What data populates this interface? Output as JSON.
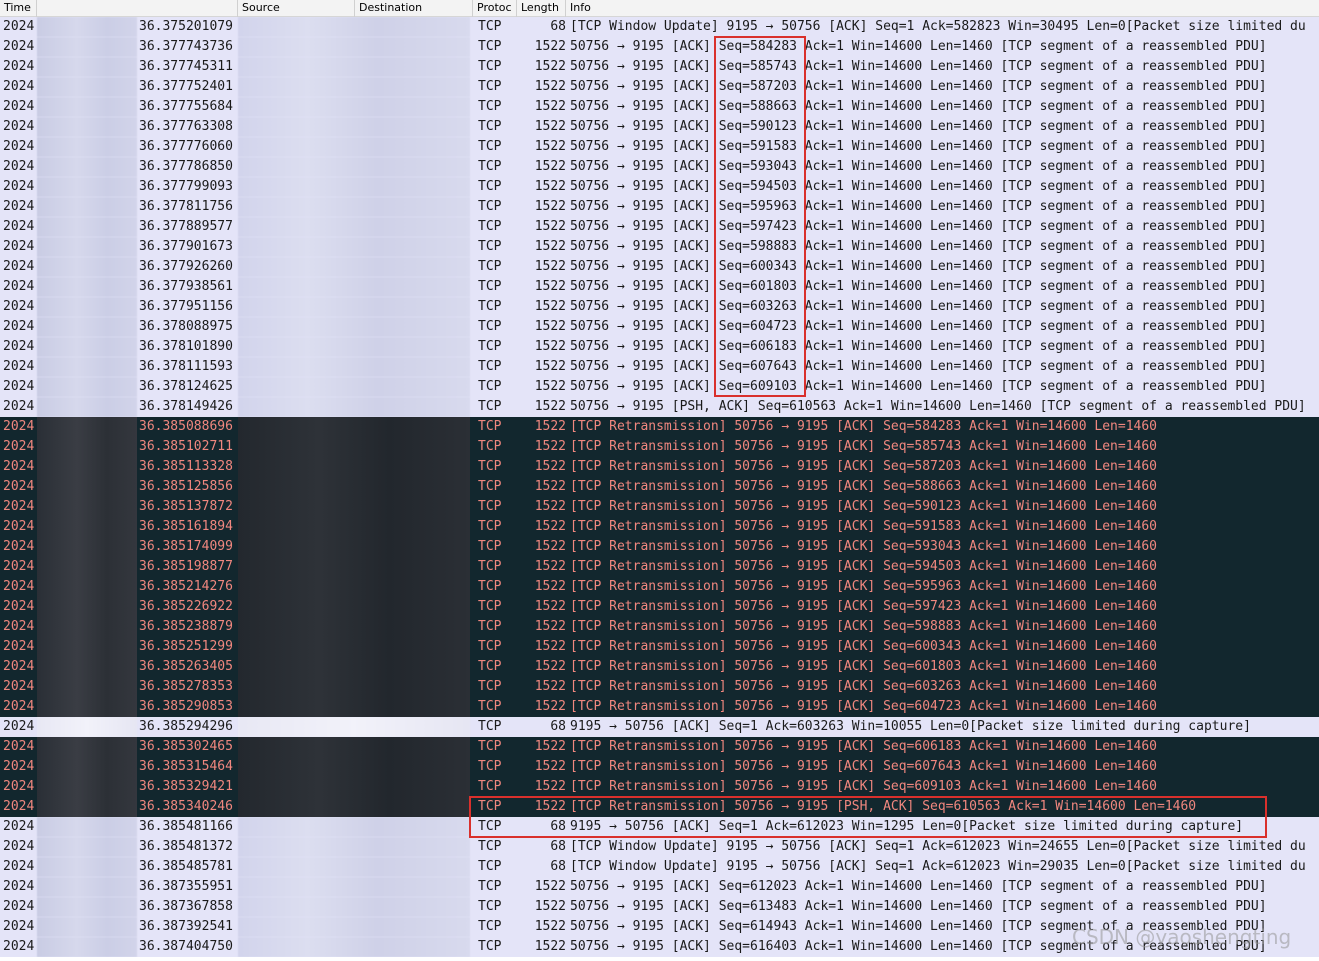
{
  "columns": {
    "time": "Time",
    "source": "Source",
    "destination": "Destination",
    "protocol": "Protoc",
    "length": "Length",
    "info": "Info"
  },
  "rows": [
    {
      "t": "2024",
      "rel": "36.375201079",
      "proto": "TCP",
      "len": "68",
      "info": "[TCP Window Update] 9195 → 50756 [ACK] Seq=1 Ack=582823 Win=30495 Len=0[Packet size limited du",
      "style": "normal"
    },
    {
      "t": "2024",
      "rel": "36.377743736",
      "proto": "TCP",
      "len": "1522",
      "info": "50756 → 9195 [ACK] Seq=584283 Ack=1 Win=14600 Len=1460 [TCP segment of a reassembled PDU]",
      "style": "normal"
    },
    {
      "t": "2024",
      "rel": "36.377745311",
      "proto": "TCP",
      "len": "1522",
      "info": "50756 → 9195 [ACK] Seq=585743 Ack=1 Win=14600 Len=1460 [TCP segment of a reassembled PDU]",
      "style": "normal"
    },
    {
      "t": "2024",
      "rel": "36.377752401",
      "proto": "TCP",
      "len": "1522",
      "info": "50756 → 9195 [ACK] Seq=587203 Ack=1 Win=14600 Len=1460 [TCP segment of a reassembled PDU]",
      "style": "normal"
    },
    {
      "t": "2024",
      "rel": "36.377755684",
      "proto": "TCP",
      "len": "1522",
      "info": "50756 → 9195 [ACK] Seq=588663 Ack=1 Win=14600 Len=1460 [TCP segment of a reassembled PDU]",
      "style": "normal"
    },
    {
      "t": "2024",
      "rel": "36.377763308",
      "proto": "TCP",
      "len": "1522",
      "info": "50756 → 9195 [ACK] Seq=590123 Ack=1 Win=14600 Len=1460 [TCP segment of a reassembled PDU]",
      "style": "normal"
    },
    {
      "t": "2024",
      "rel": "36.377776060",
      "proto": "TCP",
      "len": "1522",
      "info": "50756 → 9195 [ACK] Seq=591583 Ack=1 Win=14600 Len=1460 [TCP segment of a reassembled PDU]",
      "style": "normal"
    },
    {
      "t": "2024",
      "rel": "36.377786850",
      "proto": "TCP",
      "len": "1522",
      "info": "50756 → 9195 [ACK] Seq=593043 Ack=1 Win=14600 Len=1460 [TCP segment of a reassembled PDU]",
      "style": "normal"
    },
    {
      "t": "2024",
      "rel": "36.377799093",
      "proto": "TCP",
      "len": "1522",
      "info": "50756 → 9195 [ACK] Seq=594503 Ack=1 Win=14600 Len=1460 [TCP segment of a reassembled PDU]",
      "style": "normal"
    },
    {
      "t": "2024",
      "rel": "36.377811756",
      "proto": "TCP",
      "len": "1522",
      "info": "50756 → 9195 [ACK] Seq=595963 Ack=1 Win=14600 Len=1460 [TCP segment of a reassembled PDU]",
      "style": "normal"
    },
    {
      "t": "2024",
      "rel": "36.377889577",
      "proto": "TCP",
      "len": "1522",
      "info": "50756 → 9195 [ACK] Seq=597423 Ack=1 Win=14600 Len=1460 [TCP segment of a reassembled PDU]",
      "style": "normal"
    },
    {
      "t": "2024",
      "rel": "36.377901673",
      "proto": "TCP",
      "len": "1522",
      "info": "50756 → 9195 [ACK] Seq=598883 Ack=1 Win=14600 Len=1460 [TCP segment of a reassembled PDU]",
      "style": "normal"
    },
    {
      "t": "2024",
      "rel": "36.377926260",
      "proto": "TCP",
      "len": "1522",
      "info": "50756 → 9195 [ACK] Seq=600343 Ack=1 Win=14600 Len=1460 [TCP segment of a reassembled PDU]",
      "style": "normal"
    },
    {
      "t": "2024",
      "rel": "36.377938561",
      "proto": "TCP",
      "len": "1522",
      "info": "50756 → 9195 [ACK] Seq=601803 Ack=1 Win=14600 Len=1460 [TCP segment of a reassembled PDU]",
      "style": "normal"
    },
    {
      "t": "2024",
      "rel": "36.377951156",
      "proto": "TCP",
      "len": "1522",
      "info": "50756 → 9195 [ACK] Seq=603263 Ack=1 Win=14600 Len=1460 [TCP segment of a reassembled PDU]",
      "style": "normal"
    },
    {
      "t": "2024",
      "rel": "36.378088975",
      "proto": "TCP",
      "len": "1522",
      "info": "50756 → 9195 [ACK] Seq=604723 Ack=1 Win=14600 Len=1460 [TCP segment of a reassembled PDU]",
      "style": "normal"
    },
    {
      "t": "2024",
      "rel": "36.378101890",
      "proto": "TCP",
      "len": "1522",
      "info": "50756 → 9195 [ACK] Seq=606183 Ack=1 Win=14600 Len=1460 [TCP segment of a reassembled PDU]",
      "style": "normal"
    },
    {
      "t": "2024",
      "rel": "36.378111593",
      "proto": "TCP",
      "len": "1522",
      "info": "50756 → 9195 [ACK] Seq=607643 Ack=1 Win=14600 Len=1460 [TCP segment of a reassembled PDU]",
      "style": "normal"
    },
    {
      "t": "2024",
      "rel": "36.378124625",
      "proto": "TCP",
      "len": "1522",
      "info": "50756 → 9195 [ACK] Seq=609103 Ack=1 Win=14600 Len=1460 [TCP segment of a reassembled PDU]",
      "style": "normal"
    },
    {
      "t": "2024",
      "rel": "36.378149426",
      "proto": "TCP",
      "len": "1522",
      "info": "50756 → 9195 [PSH, ACK] Seq=610563 Ack=1 Win=14600 Len=1460 [TCP segment of a reassembled PDU]",
      "style": "normal"
    },
    {
      "t": "2024",
      "rel": "36.385088696",
      "proto": "TCP",
      "len": "1522",
      "info": "[TCP Retransmission] 50756 → 9195 [ACK] Seq=584283 Ack=1 Win=14600 Len=1460",
      "style": "retx"
    },
    {
      "t": "2024",
      "rel": "36.385102711",
      "proto": "TCP",
      "len": "1522",
      "info": "[TCP Retransmission] 50756 → 9195 [ACK] Seq=585743 Ack=1 Win=14600 Len=1460",
      "style": "retx"
    },
    {
      "t": "2024",
      "rel": "36.385113328",
      "proto": "TCP",
      "len": "1522",
      "info": "[TCP Retransmission] 50756 → 9195 [ACK] Seq=587203 Ack=1 Win=14600 Len=1460",
      "style": "retx"
    },
    {
      "t": "2024",
      "rel": "36.385125856",
      "proto": "TCP",
      "len": "1522",
      "info": "[TCP Retransmission] 50756 → 9195 [ACK] Seq=588663 Ack=1 Win=14600 Len=1460",
      "style": "retx"
    },
    {
      "t": "2024",
      "rel": "36.385137872",
      "proto": "TCP",
      "len": "1522",
      "info": "[TCP Retransmission] 50756 → 9195 [ACK] Seq=590123 Ack=1 Win=14600 Len=1460",
      "style": "retx"
    },
    {
      "t": "2024",
      "rel": "36.385161894",
      "proto": "TCP",
      "len": "1522",
      "info": "[TCP Retransmission] 50756 → 9195 [ACK] Seq=591583 Ack=1 Win=14600 Len=1460",
      "style": "retx"
    },
    {
      "t": "2024",
      "rel": "36.385174099",
      "proto": "TCP",
      "len": "1522",
      "info": "[TCP Retransmission] 50756 → 9195 [ACK] Seq=593043 Ack=1 Win=14600 Len=1460",
      "style": "retx"
    },
    {
      "t": "2024",
      "rel": "36.385198877",
      "proto": "TCP",
      "len": "1522",
      "info": "[TCP Retransmission] 50756 → 9195 [ACK] Seq=594503 Ack=1 Win=14600 Len=1460",
      "style": "retx"
    },
    {
      "t": "2024",
      "rel": "36.385214276",
      "proto": "TCP",
      "len": "1522",
      "info": "[TCP Retransmission] 50756 → 9195 [ACK] Seq=595963 Ack=1 Win=14600 Len=1460",
      "style": "retx"
    },
    {
      "t": "2024",
      "rel": "36.385226922",
      "proto": "TCP",
      "len": "1522",
      "info": "[TCP Retransmission] 50756 → 9195 [ACK] Seq=597423 Ack=1 Win=14600 Len=1460",
      "style": "retx"
    },
    {
      "t": "2024",
      "rel": "36.385238879",
      "proto": "TCP",
      "len": "1522",
      "info": "[TCP Retransmission] 50756 → 9195 [ACK] Seq=598883 Ack=1 Win=14600 Len=1460",
      "style": "retx"
    },
    {
      "t": "2024",
      "rel": "36.385251299",
      "proto": "TCP",
      "len": "1522",
      "info": "[TCP Retransmission] 50756 → 9195 [ACK] Seq=600343 Ack=1 Win=14600 Len=1460",
      "style": "retx"
    },
    {
      "t": "2024",
      "rel": "36.385263405",
      "proto": "TCP",
      "len": "1522",
      "info": "[TCP Retransmission] 50756 → 9195 [ACK] Seq=601803 Ack=1 Win=14600 Len=1460",
      "style": "retx"
    },
    {
      "t": "2024",
      "rel": "36.385278353",
      "proto": "TCP",
      "len": "1522",
      "info": "[TCP Retransmission] 50756 → 9195 [ACK] Seq=603263 Ack=1 Win=14600 Len=1460",
      "style": "retx"
    },
    {
      "t": "2024",
      "rel": "36.385290853",
      "proto": "TCP",
      "len": "1522",
      "info": "[TCP Retransmission] 50756 → 9195 [ACK] Seq=604723 Ack=1 Win=14600 Len=1460",
      "style": "retx"
    },
    {
      "t": "2024",
      "rel": "36.385294296",
      "proto": "TCP",
      "len": "68",
      "info": "9195 → 50756 [ACK] Seq=1 Ack=603263 Win=10055 Len=0[Packet size limited during capture]",
      "style": "pale"
    },
    {
      "t": "2024",
      "rel": "36.385302465",
      "proto": "TCP",
      "len": "1522",
      "info": "[TCP Retransmission] 50756 → 9195 [ACK] Seq=606183 Ack=1 Win=14600 Len=1460",
      "style": "retx"
    },
    {
      "t": "2024",
      "rel": "36.385315464",
      "proto": "TCP",
      "len": "1522",
      "info": "[TCP Retransmission] 50756 → 9195 [ACK] Seq=607643 Ack=1 Win=14600 Len=1460",
      "style": "retx"
    },
    {
      "t": "2024",
      "rel": "36.385329421",
      "proto": "TCP",
      "len": "1522",
      "info": "[TCP Retransmission] 50756 → 9195 [ACK] Seq=609103 Ack=1 Win=14600 Len=1460",
      "style": "retx"
    },
    {
      "t": "2024",
      "rel": "36.385340246",
      "proto": "TCP",
      "len": "1522",
      "info": "[TCP Retransmission] 50756 → 9195 [PSH, ACK] Seq=610563 Ack=1 Win=14600 Len=1460",
      "style": "retx"
    },
    {
      "t": "2024",
      "rel": "36.385481166",
      "proto": "TCP",
      "len": "68",
      "info": "9195 → 50756 [ACK] Seq=1 Ack=612023 Win=1295 Len=0[Packet size limited during capture]",
      "style": "normal"
    },
    {
      "t": "2024",
      "rel": "36.385481372",
      "proto": "TCP",
      "len": "68",
      "info": "[TCP Window Update] 9195 → 50756 [ACK] Seq=1 Ack=612023 Win=24655 Len=0[Packet size limited du",
      "style": "normal"
    },
    {
      "t": "2024",
      "rel": "36.385485781",
      "proto": "TCP",
      "len": "68",
      "info": "[TCP Window Update] 9195 → 50756 [ACK] Seq=1 Ack=612023 Win=29035 Len=0[Packet size limited du",
      "style": "normal"
    },
    {
      "t": "2024",
      "rel": "36.387355951",
      "proto": "TCP",
      "len": "1522",
      "info": "50756 → 9195 [ACK] Seq=612023 Ack=1 Win=14600 Len=1460 [TCP segment of a reassembled PDU]",
      "style": "normal"
    },
    {
      "t": "2024",
      "rel": "36.387367858",
      "proto": "TCP",
      "len": "1522",
      "info": "50756 → 9195 [ACK] Seq=613483 Ack=1 Win=14600 Len=1460 [TCP segment of a reassembled PDU]",
      "style": "normal"
    },
    {
      "t": "2024",
      "rel": "36.387392541",
      "proto": "TCP",
      "len": "1522",
      "info": "50756 → 9195 [ACK] Seq=614943 Ack=1 Win=14600 Len=1460 [TCP segment of a reassembled PDU]",
      "style": "normal"
    },
    {
      "t": "2024",
      "rel": "36.387404750",
      "proto": "TCP",
      "len": "1522",
      "info": "50756 → 9195 [ACK] Seq=616403 Ack=1 Win=14600 Len=1460 [TCP segment of a reassembled PDU]",
      "style": "normal"
    }
  ],
  "watermark": "CSDN @yaoshengting",
  "colors": {
    "normal_bg": "#e4e4f8",
    "retransmission_bg": "#12272e",
    "retransmission_fg": "#f0877f",
    "highlight_box": "#d9302c"
  }
}
